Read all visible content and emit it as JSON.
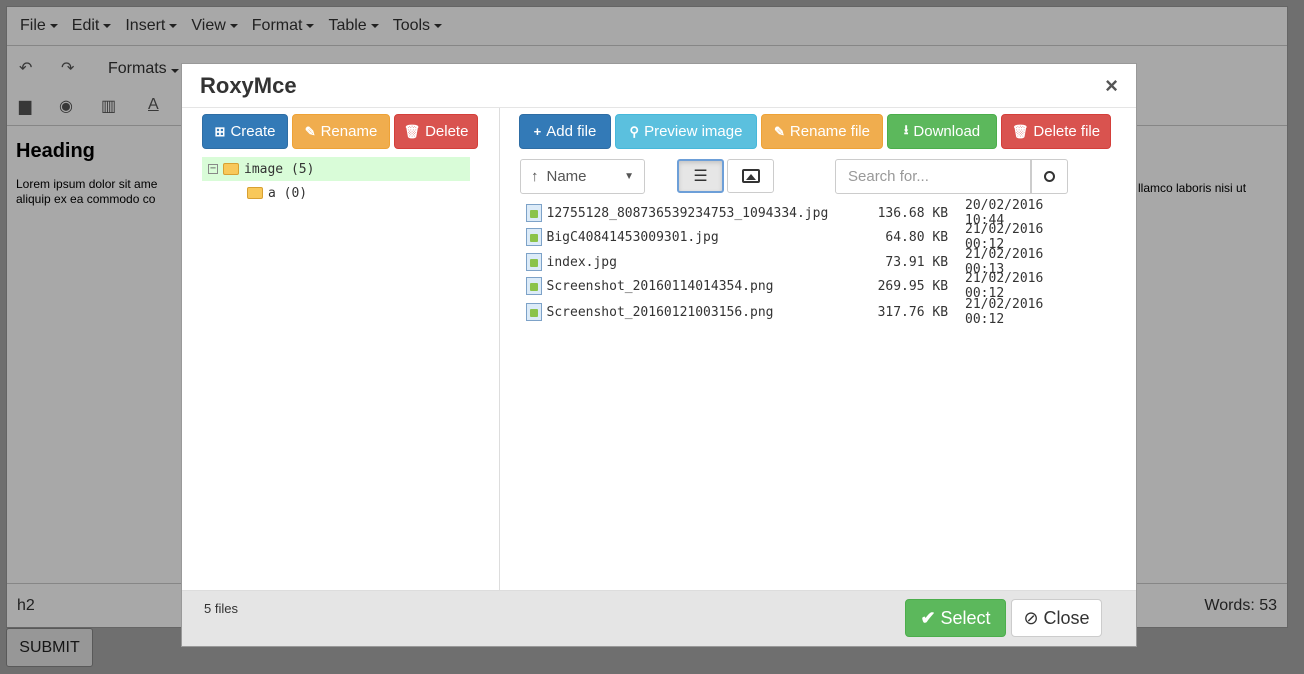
{
  "menubar": {
    "items": [
      "File",
      "Edit",
      "Insert",
      "View",
      "Format",
      "Table",
      "Tools"
    ]
  },
  "toolbar": {
    "formats_label": "Formats"
  },
  "content": {
    "heading": "Heading",
    "paragraph_left": "Lorem ipsum dolor sit ame",
    "paragraph_left2": "aliquip ex ea commodo co",
    "paragraph_right": "llamco laboris nisi ut"
  },
  "statusbar": {
    "path": "h2",
    "words": "Words: 53"
  },
  "submit_label": "SUBMIT",
  "modal": {
    "title": "RoxyMce",
    "close_glyph": "×",
    "left_buttons": [
      {
        "label": "Create",
        "icon": "plus-square-icon"
      },
      {
        "label": "Rename",
        "icon": "pencil-square-icon"
      },
      {
        "label": "Delete",
        "icon": "trash-icon"
      }
    ],
    "tree": [
      {
        "label": "image (5)",
        "selected": true
      },
      {
        "label": "a (0)",
        "selected": false
      }
    ],
    "right_buttons": [
      {
        "label": "Add file",
        "icon": "plus-icon"
      },
      {
        "label": "Preview image",
        "icon": "search-icon"
      },
      {
        "label": "Rename file",
        "icon": "pencil-icon"
      },
      {
        "label": "Download",
        "icon": "download-icon"
      },
      {
        "label": "Delete file",
        "icon": "trash-icon"
      }
    ],
    "sort": {
      "label": "Name",
      "arrow": "↑"
    },
    "search_placeholder": "Search for...",
    "files": [
      {
        "name": "12755128_808736539234753_1094334.jpg",
        "size": "136.68 KB",
        "date": "20/02/2016 10:44"
      },
      {
        "name": "BigC40841453009301.jpg",
        "size": "64.80 KB",
        "date": "21/02/2016 00:12"
      },
      {
        "name": "index.jpg",
        "size": "73.91 KB",
        "date": "21/02/2016 00:13"
      },
      {
        "name": "Screenshot_20160114014354.png",
        "size": "269.95 KB",
        "date": "21/02/2016 00:12"
      },
      {
        "name": "Screenshot_20160121003156.png",
        "size": "317.76 KB",
        "date": "21/02/2016 00:12"
      }
    ],
    "file_count": "5 files",
    "select_label": "Select",
    "close_label": "Close"
  }
}
